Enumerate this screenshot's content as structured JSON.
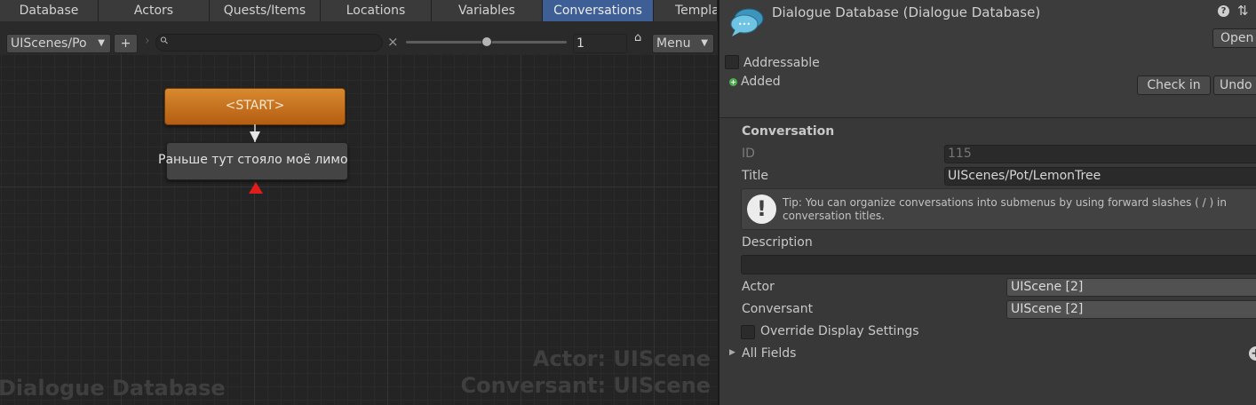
{
  "tabs": [
    "Database",
    "Actors",
    "Quests/Items",
    "Locations",
    "Variables",
    "Conversations",
    "Templa"
  ],
  "toolbar": {
    "conversation_select": "UIScenes/Po",
    "add_label": "+",
    "breadcrumb_arrow": "›",
    "search_icon_glyph": "⚲",
    "search_value": "",
    "clear_label": "×",
    "zoom_slider_level": 0.5,
    "zoom_value": "1",
    "lock_glyph": "⌂",
    "menu_label": "Menu"
  },
  "canvas": {
    "start_node_label": "<START>",
    "dialogue_node_label": "Раньше тут стояло моё лимо",
    "watermark_database": "Dialogue Database",
    "watermark_actor": "Actor: UIScene",
    "watermark_conversant": "Conversant: UIScene"
  },
  "inspector": {
    "title": "Dialogue Database (Dialogue Database)",
    "help_icon_glyph": "?",
    "settings_icon_glyph": "⇅",
    "open_label": "Open",
    "addressable_label": "Addressable",
    "added_label": "Added",
    "check_in_label": "Check in",
    "undo_label": "Undo",
    "section_label": "Conversation",
    "id_label": "ID",
    "id_value": "115",
    "title_label": "Title",
    "title_value": "UIScenes/Pot/LemonTree",
    "tip_text": "Tip: You can organize conversations into submenus by using forward slashes ( / ) in conversation titles.",
    "description_label": "Description",
    "description_value": "",
    "actor_label": "Actor",
    "actor_value": "UIScene [2]",
    "conversant_label": "Conversant",
    "conversant_value": "UIScene [2]",
    "override_label": "Override Display Settings",
    "all_fields_label": "All Fields",
    "add_field_glyph": "+"
  },
  "colors": {
    "active_tab": "#3e5f96",
    "start_node": "#c87320",
    "link_arrow": "#e21b1b",
    "added_badge": "#4caf50"
  }
}
